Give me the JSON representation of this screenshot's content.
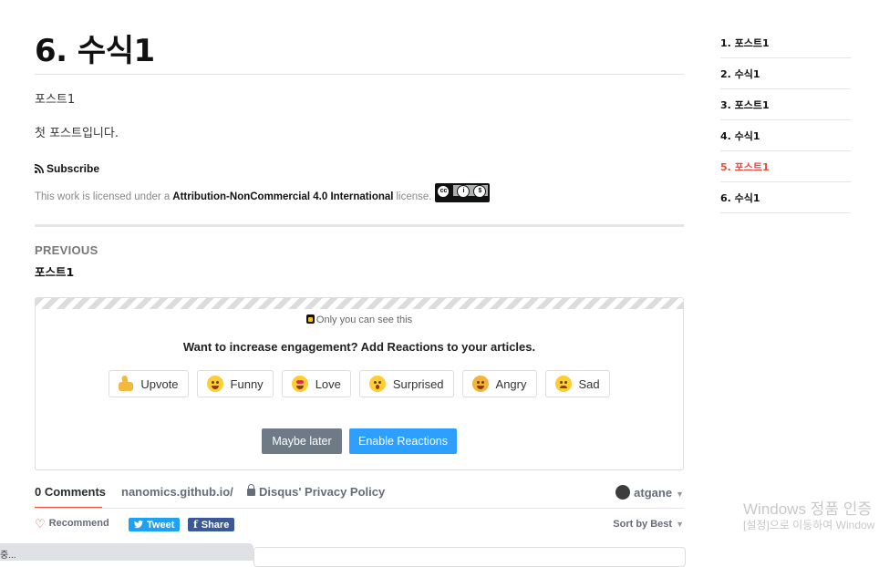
{
  "post": {
    "title": "6. 수식1",
    "paragraph1": "포스트1",
    "paragraph2": "첫 포스트입니다.",
    "subscribe_label": "Subscribe",
    "license_prefix": "This work is licensed under a",
    "license_name": "Attribution-NonCommercial 4.0 International",
    "license_suffix": "license.",
    "license_badge_text": "BY NC"
  },
  "prev": {
    "label": "PREVIOUS",
    "title": "포스트1"
  },
  "reactions": {
    "only_you": "Only you can see this",
    "prompt": "Want to increase engagement? Add Reactions to your articles.",
    "items": [
      {
        "label": "Upvote",
        "icon": "thumbs-up-icon"
      },
      {
        "label": "Funny",
        "icon": "laughing-face-icon"
      },
      {
        "label": "Love",
        "icon": "heart-eyes-icon"
      },
      {
        "label": "Surprised",
        "icon": "surprised-face-icon"
      },
      {
        "label": "Angry",
        "icon": "angry-face-icon"
      },
      {
        "label": "Sad",
        "icon": "sad-face-icon"
      }
    ],
    "later_label": "Maybe later",
    "enable_label": "Enable Reactions",
    "colors": {
      "enable": "#2e9fff",
      "later": "#6e7a86"
    }
  },
  "disqus": {
    "tabs": {
      "comments": "0 Comments",
      "site": "nanomics.github.io/",
      "privacy": "Disqus' Privacy Policy"
    },
    "user": "atgane",
    "recommend": "Recommend",
    "tweet": "Tweet",
    "share": "Share",
    "sort": "Sort by Best"
  },
  "toc": {
    "items": [
      {
        "label": "1. 포스트1",
        "active": false
      },
      {
        "label": "2. 수식1",
        "active": false
      },
      {
        "label": "3. 포스트1",
        "active": false
      },
      {
        "label": "4. 수식1",
        "active": false
      },
      {
        "label": "5. 포스트1",
        "active": true
      },
      {
        "label": "6. 수식1",
        "active": false
      }
    ],
    "active_color": "#e74c3c"
  },
  "overlay": {
    "watermark_line1": "Windows 정품 인증",
    "watermark_line2": "[설정]으로 이동하여 Window",
    "status_text": "중..."
  }
}
